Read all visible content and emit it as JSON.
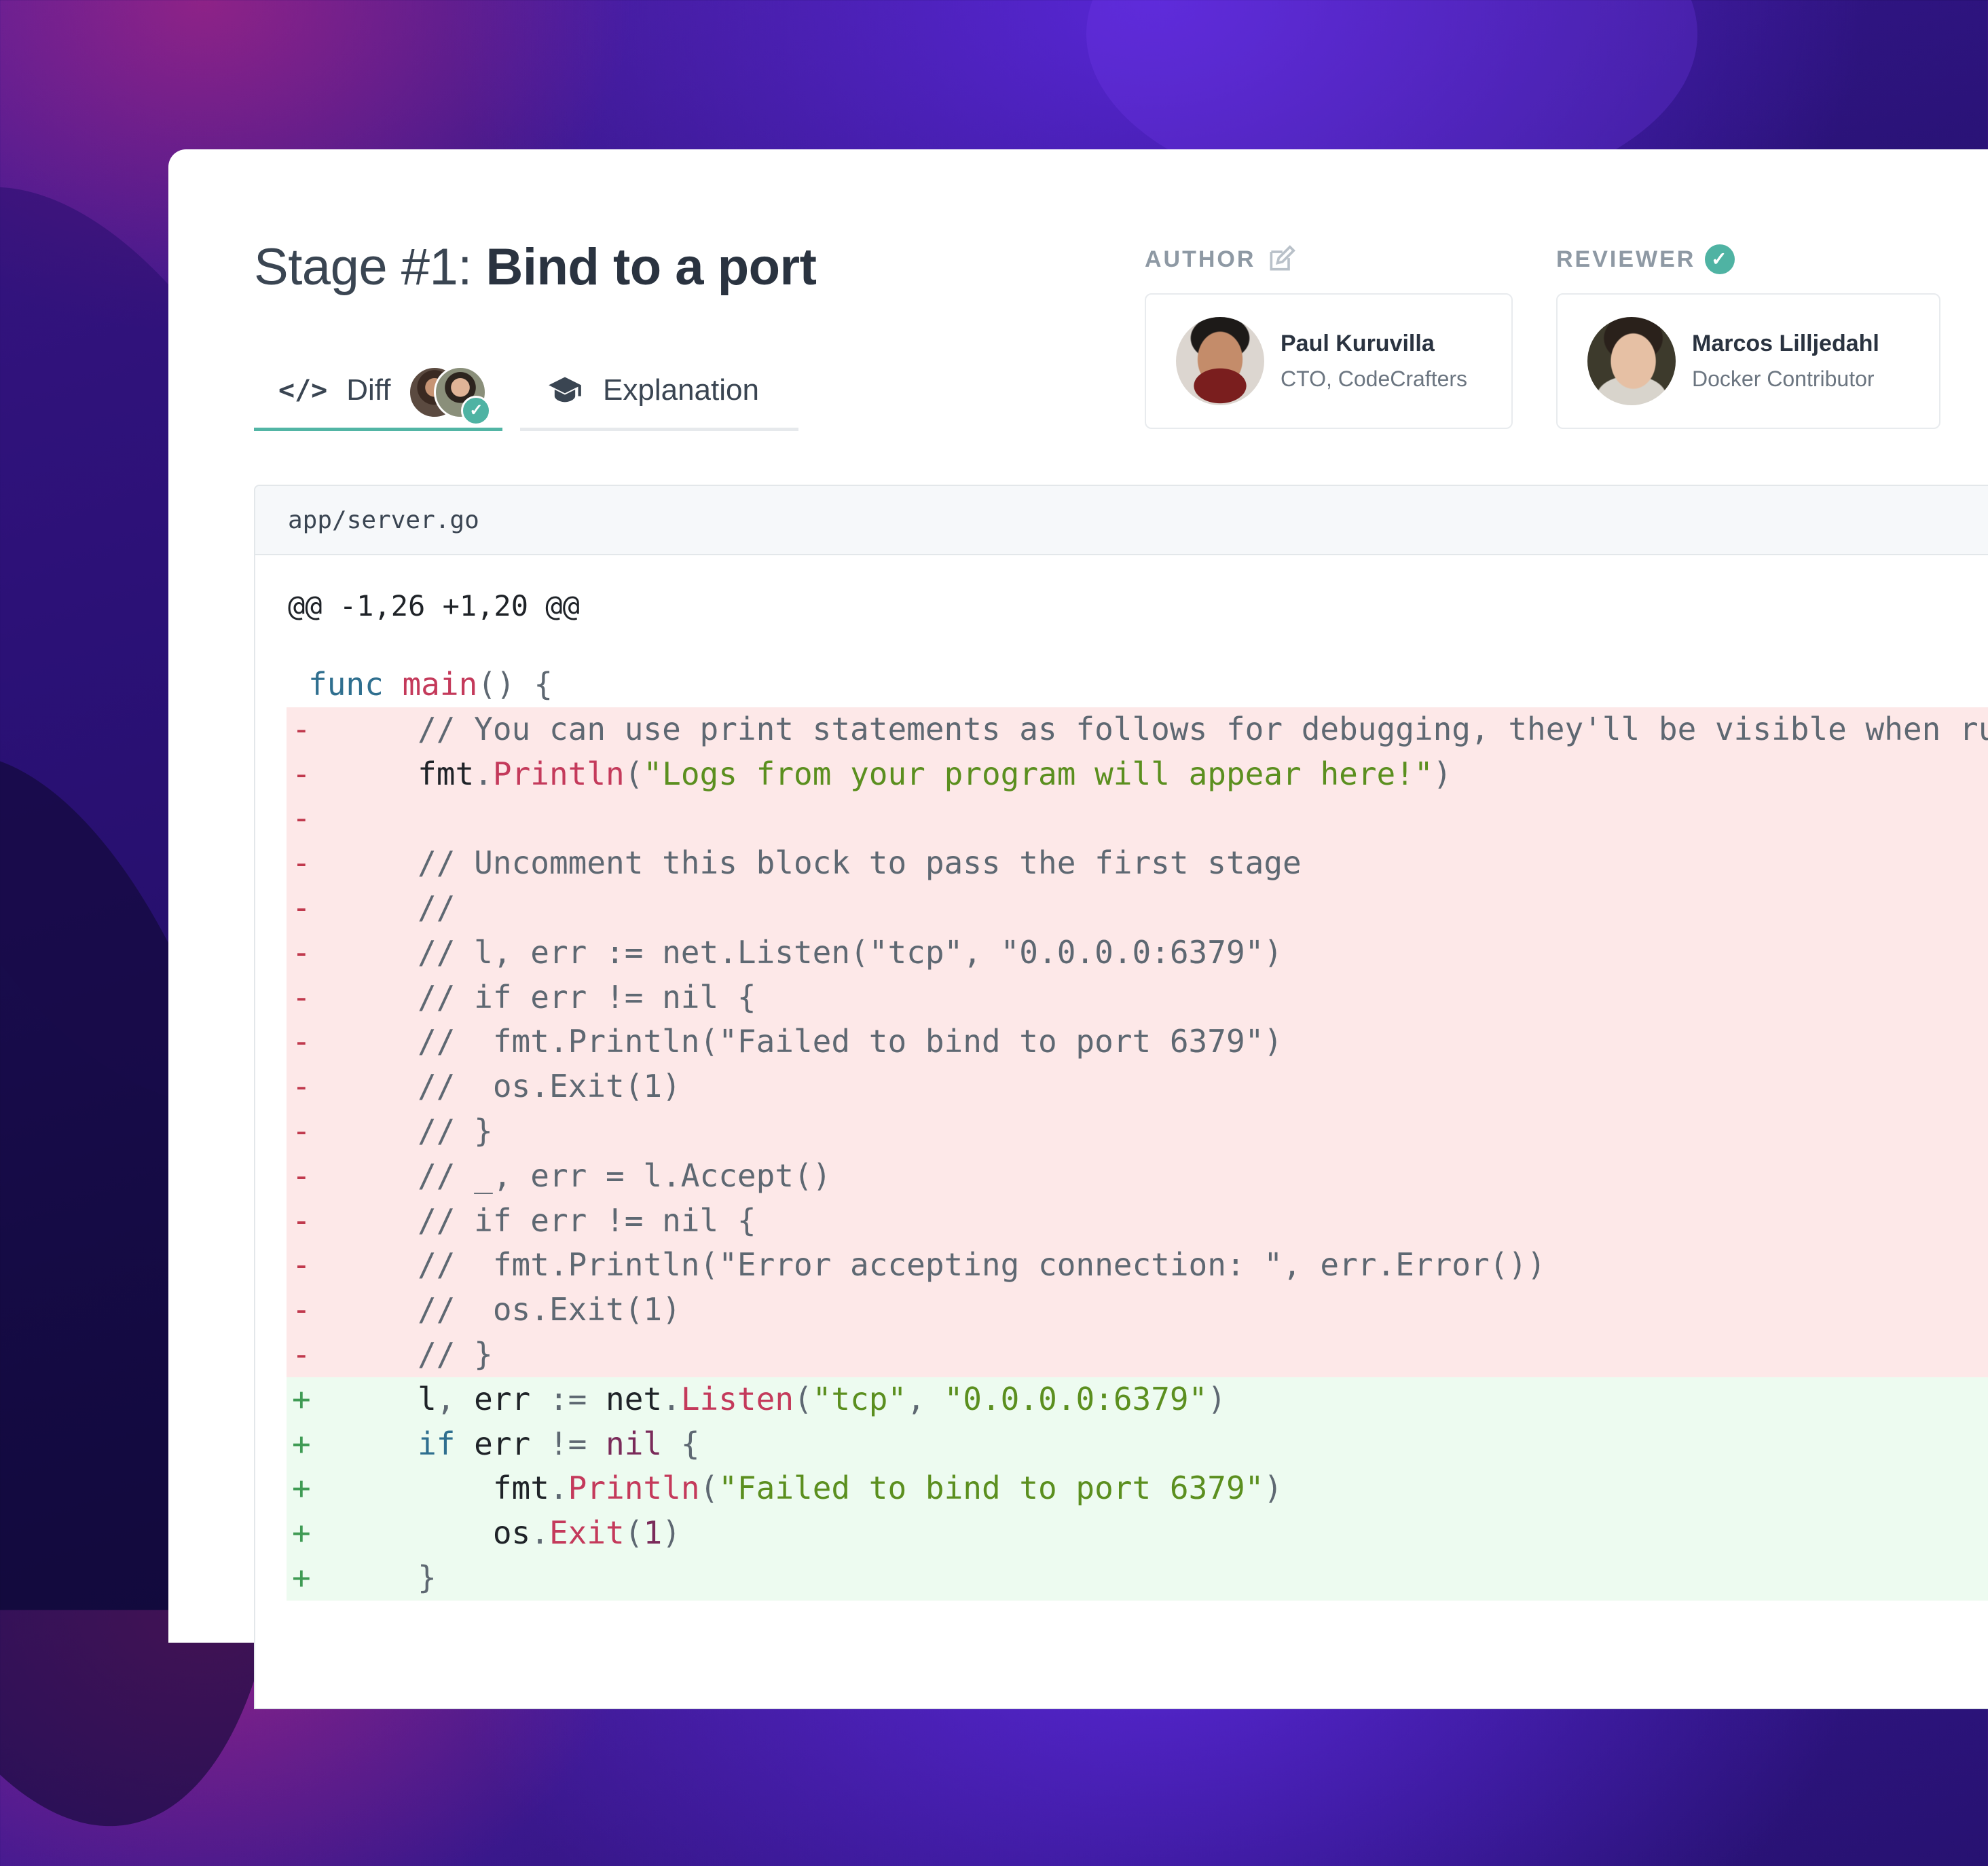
{
  "stage": {
    "prefix": "Stage #1:",
    "title": "Bind to a port"
  },
  "tabs": {
    "diff_label": "Diff",
    "explanation_label": "Explanation"
  },
  "author": {
    "role_label": "AUTHOR",
    "name": "Paul Kuruvilla",
    "title": "CTO, CodeCrafters"
  },
  "reviewer": {
    "role_label": "REVIEWER",
    "name": "Marcos Lilljedahl",
    "title": "Docker Contributor"
  },
  "file": {
    "path": "app/server.go",
    "hunk": "@@ -1,26 +1,20 @@"
  },
  "colors": {
    "accent": "#52b5a5",
    "deleted_bg": "#fde8e8",
    "added_bg": "#edfbf0"
  },
  "icons": {
    "diff": "code-icon",
    "explanation": "graduation-cap-icon",
    "author": "edit-icon",
    "reviewer": "verified-check-icon"
  },
  "diff_lines": [
    {
      "type": "ctx",
      "sign": "",
      "tokens": [
        [
          "kw",
          "func "
        ],
        [
          "fn",
          "main"
        ],
        [
          "pn",
          "() {"
        ]
      ]
    },
    {
      "type": "del",
      "sign": "-",
      "tokens": [
        [
          "cm",
          "   // You can use print statements as follows for debugging, they'll be visible when running tests."
        ]
      ]
    },
    {
      "type": "del",
      "sign": "-",
      "tokens": [
        [
          "pl",
          "   fmt"
        ],
        [
          "pn",
          "."
        ],
        [
          "fn",
          "Println"
        ],
        [
          "pn",
          "("
        ],
        [
          "str",
          "\"Logs from your program will appear here!\""
        ],
        [
          "pn",
          ")"
        ]
      ]
    },
    {
      "type": "del",
      "sign": "-",
      "tokens": []
    },
    {
      "type": "del",
      "sign": "-",
      "tokens": [
        [
          "cm",
          "   // Uncomment this block to pass the first stage"
        ]
      ]
    },
    {
      "type": "del",
      "sign": "-",
      "tokens": [
        [
          "cm",
          "   //"
        ]
      ]
    },
    {
      "type": "del",
      "sign": "-",
      "tokens": [
        [
          "cm",
          "   // l, err := net.Listen(\"tcp\", \"0.0.0.0:6379\")"
        ]
      ]
    },
    {
      "type": "del",
      "sign": "-",
      "tokens": [
        [
          "cm",
          "   // if err != nil {"
        ]
      ]
    },
    {
      "type": "del",
      "sign": "-",
      "tokens": [
        [
          "cm",
          "   //  fmt.Println(\"Failed to bind to port 6379\")"
        ]
      ]
    },
    {
      "type": "del",
      "sign": "-",
      "tokens": [
        [
          "cm",
          "   //  os.Exit(1)"
        ]
      ]
    },
    {
      "type": "del",
      "sign": "-",
      "tokens": [
        [
          "cm",
          "   // }"
        ]
      ]
    },
    {
      "type": "del",
      "sign": "-",
      "tokens": [
        [
          "cm",
          "   // _, err = l.Accept()"
        ]
      ]
    },
    {
      "type": "del",
      "sign": "-",
      "tokens": [
        [
          "cm",
          "   // if err != nil {"
        ]
      ]
    },
    {
      "type": "del",
      "sign": "-",
      "tokens": [
        [
          "cm",
          "   //  fmt.Println(\"Error accepting connection: \", err.Error())"
        ]
      ]
    },
    {
      "type": "del",
      "sign": "-",
      "tokens": [
        [
          "cm",
          "   //  os.Exit(1)"
        ]
      ]
    },
    {
      "type": "del",
      "sign": "-",
      "tokens": [
        [
          "cm",
          "   // }"
        ]
      ]
    },
    {
      "type": "add",
      "sign": "+",
      "tokens": [
        [
          "pl",
          "   l"
        ],
        [
          "pn",
          ", "
        ],
        [
          "pl",
          "err "
        ],
        [
          "pn",
          ":= "
        ],
        [
          "pl",
          "net"
        ],
        [
          "pn",
          "."
        ],
        [
          "fn",
          "Listen"
        ],
        [
          "pn",
          "("
        ],
        [
          "str",
          "\"tcp\""
        ],
        [
          "pn",
          ", "
        ],
        [
          "str",
          "\"0.0.0.0:6379\""
        ],
        [
          "pn",
          ")"
        ]
      ]
    },
    {
      "type": "add",
      "sign": "+",
      "tokens": [
        [
          "kw",
          "   if "
        ],
        [
          "pl",
          "err "
        ],
        [
          "pn",
          "!= "
        ],
        [
          "nl",
          "nil"
        ],
        [
          "pn",
          " {"
        ]
      ]
    },
    {
      "type": "add",
      "sign": "+",
      "tokens": [
        [
          "pl",
          "       fmt"
        ],
        [
          "pn",
          "."
        ],
        [
          "fn",
          "Println"
        ],
        [
          "pn",
          "("
        ],
        [
          "str",
          "\"Failed to bind to port 6379\""
        ],
        [
          "pn",
          ")"
        ]
      ]
    },
    {
      "type": "add",
      "sign": "+",
      "tokens": [
        [
          "pl",
          "       os"
        ],
        [
          "pn",
          "."
        ],
        [
          "fn",
          "Exit"
        ],
        [
          "pn",
          "("
        ],
        [
          "num",
          "1"
        ],
        [
          "pn",
          ")"
        ]
      ]
    },
    {
      "type": "add",
      "sign": "+",
      "tokens": [
        [
          "pn",
          "   }"
        ]
      ]
    }
  ]
}
